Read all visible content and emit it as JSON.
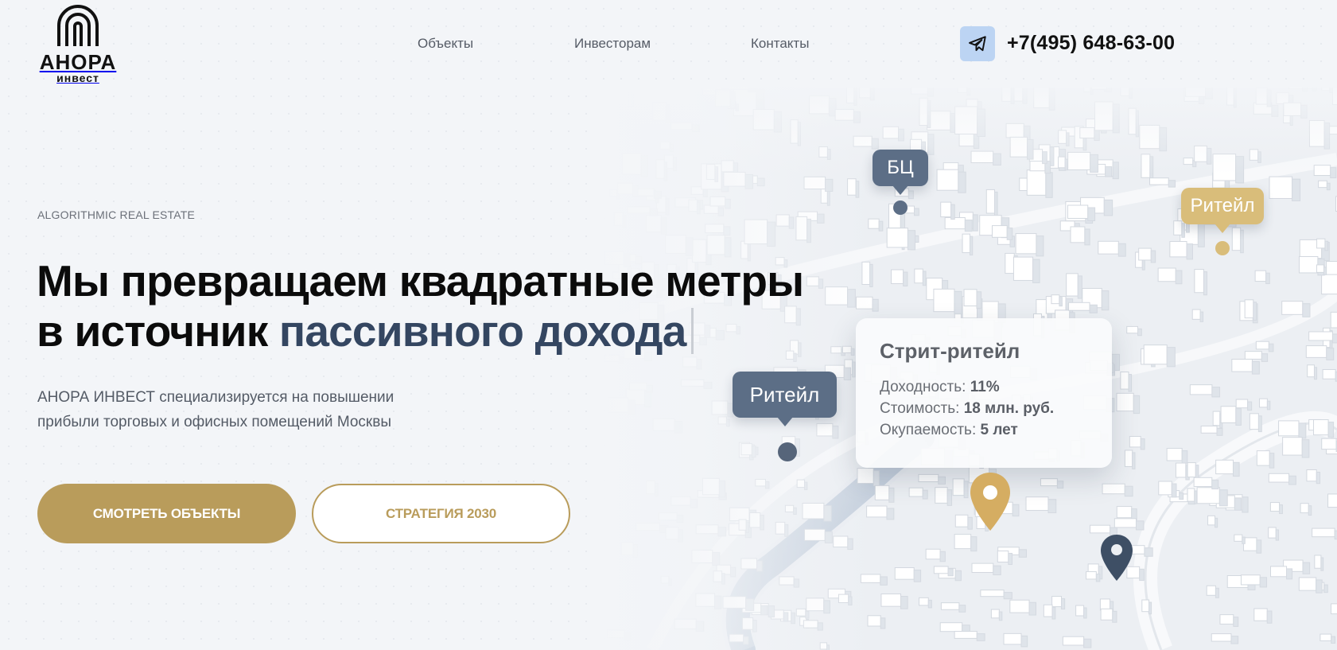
{
  "header": {
    "logo": {
      "name": "АНОРА",
      "sub": "инвест"
    },
    "nav": [
      "Объекты",
      "Инвесторам",
      "Контакты"
    ],
    "phone": "+7(495) 648-63-00"
  },
  "hero": {
    "eyebrow": "ALGORITHMIC REAL ESTATE",
    "title_line1": "Мы превращаем квадратные метры",
    "title_line2_prefix": "в источник ",
    "title_line2_accent": "пассивного дохода",
    "lead": "АНОРА ИНВЕСТ специализируется на повышении прибыли торговых и офисных помещений Москвы",
    "btn_primary": "СМОТРЕТЬ ОБЪЕКТЫ",
    "btn_secondary": "СТРАТЕГИЯ 2030"
  },
  "map": {
    "tags": {
      "bc": "БЦ",
      "retail_gold": "Ритейл",
      "retail_dark": "Ритейл"
    },
    "card": {
      "title": "Стрит-ритейл",
      "rows": [
        {
          "label": "Доходность: ",
          "value": "11%"
        },
        {
          "label": "Стоимость: ",
          "value": "18 млн. руб."
        },
        {
          "label": "Окупаемость: ",
          "value": "5 лет"
        }
      ]
    }
  },
  "colors": {
    "gold": "#b99c5b",
    "navy_accent": "#344661",
    "telegram_button": "#bcd4f3",
    "tag_dark": "#5c6e86",
    "tag_gold": "#d9bd7a"
  },
  "icons": [
    "logo-arch-icon",
    "telegram-icon",
    "map-pin-gold-icon",
    "map-pin-dark-icon"
  ]
}
